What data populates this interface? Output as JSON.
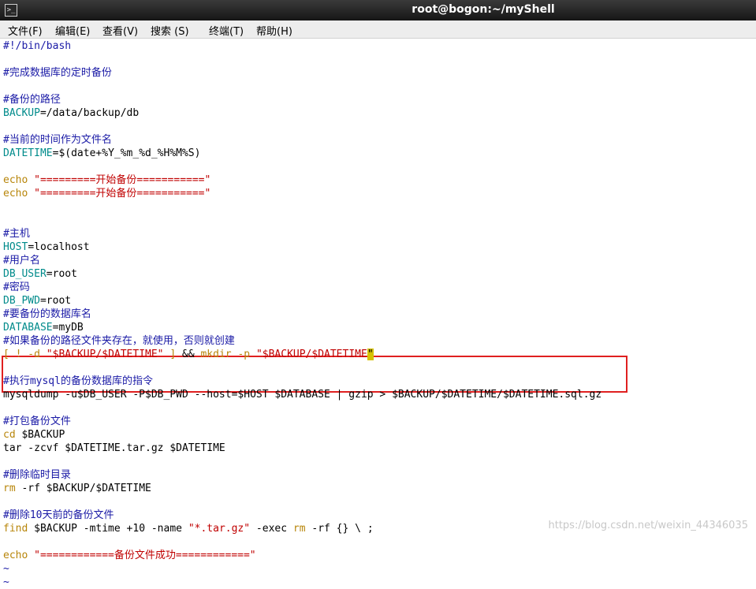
{
  "window": {
    "title": "root@bogon:~/myShell",
    "icon": "terminal-icon"
  },
  "menu": [
    {
      "label": "文件(F)"
    },
    {
      "label": "编辑(E)"
    },
    {
      "label": "查看(V)"
    },
    {
      "label": "搜索 (S)"
    },
    {
      "label": "终端(T)"
    },
    {
      "label": "帮助(H)"
    }
  ],
  "editor": {
    "lines": [
      [
        {
          "t": "#!/bin/bash",
          "c": "c"
        }
      ],
      [],
      [
        {
          "t": "#完成数据库的定时备份",
          "c": "c"
        }
      ],
      [],
      [
        {
          "t": "#备份的路径",
          "c": "c"
        }
      ],
      [
        {
          "t": "BACKUP",
          "c": "v"
        },
        {
          "t": "=/data/backup/db",
          "c": ""
        }
      ],
      [],
      [
        {
          "t": "#当前的时间作为文件名",
          "c": "c"
        }
      ],
      [
        {
          "t": "DATETIME",
          "c": "v"
        },
        {
          "t": "=$(date+%Y_%m_%d_%H%M%S)",
          "c": ""
        }
      ],
      [],
      [
        {
          "t": "echo ",
          "c": "y"
        },
        {
          "t": "\"=========开始备份===========\"",
          "c": "s"
        }
      ],
      [
        {
          "t": "echo ",
          "c": "y"
        },
        {
          "t": "\"=========开始备份===========\"",
          "c": "s"
        }
      ],
      [],
      [],
      [
        {
          "t": "#主机",
          "c": "c"
        }
      ],
      [
        {
          "t": "HOST",
          "c": "v"
        },
        {
          "t": "=localhost",
          "c": ""
        }
      ],
      [
        {
          "t": "#用户名",
          "c": "c"
        }
      ],
      [
        {
          "t": "DB_USER",
          "c": "v"
        },
        {
          "t": "=root",
          "c": ""
        }
      ],
      [
        {
          "t": "#密码",
          "c": "c"
        }
      ],
      [
        {
          "t": "DB_PWD",
          "c": "v"
        },
        {
          "t": "=root",
          "c": ""
        }
      ],
      [
        {
          "t": "#要备份的数据库名",
          "c": "c"
        }
      ],
      [
        {
          "t": "DATABASE",
          "c": "v"
        },
        {
          "t": "=myDB",
          "c": ""
        }
      ],
      [
        {
          "t": "#如果备份的路径文件夹存在，就使用，否则就创建",
          "c": "c"
        }
      ],
      [
        {
          "t": "[ ! -d ",
          "c": "y"
        },
        {
          "t": "\"$BACKUP/$DATETIME\"",
          "c": "s"
        },
        {
          "t": " ] ",
          "c": "y"
        },
        {
          "t": "&& ",
          "c": ""
        },
        {
          "t": "mkdir -p ",
          "c": "y"
        },
        {
          "t": "\"$BACKUP/$DATETIME",
          "c": "s"
        },
        {
          "t": "\"",
          "c": "cursor"
        }
      ],
      [],
      [
        {
          "t": "#执行mysql的备份数据库的指令",
          "c": "c"
        }
      ],
      [
        {
          "t": "mysqldump -u$DB_USER -P$DB_PWD --host=$HOST $DATABASE | gzip > $BACKUP/$DATETIME/$DATETIME.sql.gz",
          "c": ""
        }
      ],
      [],
      [
        {
          "t": "#打包备份文件",
          "c": "c"
        }
      ],
      [
        {
          "t": "cd ",
          "c": "y"
        },
        {
          "t": "$BACKUP",
          "c": ""
        }
      ],
      [
        {
          "t": "tar -zcvf $DATETIME.tar.gz $DATETIME",
          "c": ""
        }
      ],
      [],
      [
        {
          "t": "#删除临时目录",
          "c": "c"
        }
      ],
      [
        {
          "t": "rm ",
          "c": "y"
        },
        {
          "t": "-rf $BACKUP/$DATETIME",
          "c": ""
        }
      ],
      [],
      [
        {
          "t": "#删除10天前的备份文件",
          "c": "c"
        }
      ],
      [
        {
          "t": "find ",
          "c": "y"
        },
        {
          "t": "$BACKUP -mtime +10 -name ",
          "c": ""
        },
        {
          "t": "\"*.tar.gz\"",
          "c": "s"
        },
        {
          "t": " -exec ",
          "c": ""
        },
        {
          "t": "rm ",
          "c": "y"
        },
        {
          "t": "-rf {} \\ ;",
          "c": ""
        }
      ],
      [],
      [
        {
          "t": "echo ",
          "c": "y"
        },
        {
          "t": "\"============备份文件成功============\"",
          "c": "s"
        }
      ],
      [
        {
          "t": "~",
          "c": "b"
        }
      ],
      [
        {
          "t": "~",
          "c": "b"
        }
      ]
    ]
  },
  "watermark": "https://blog.csdn.net/weixin_44346035"
}
